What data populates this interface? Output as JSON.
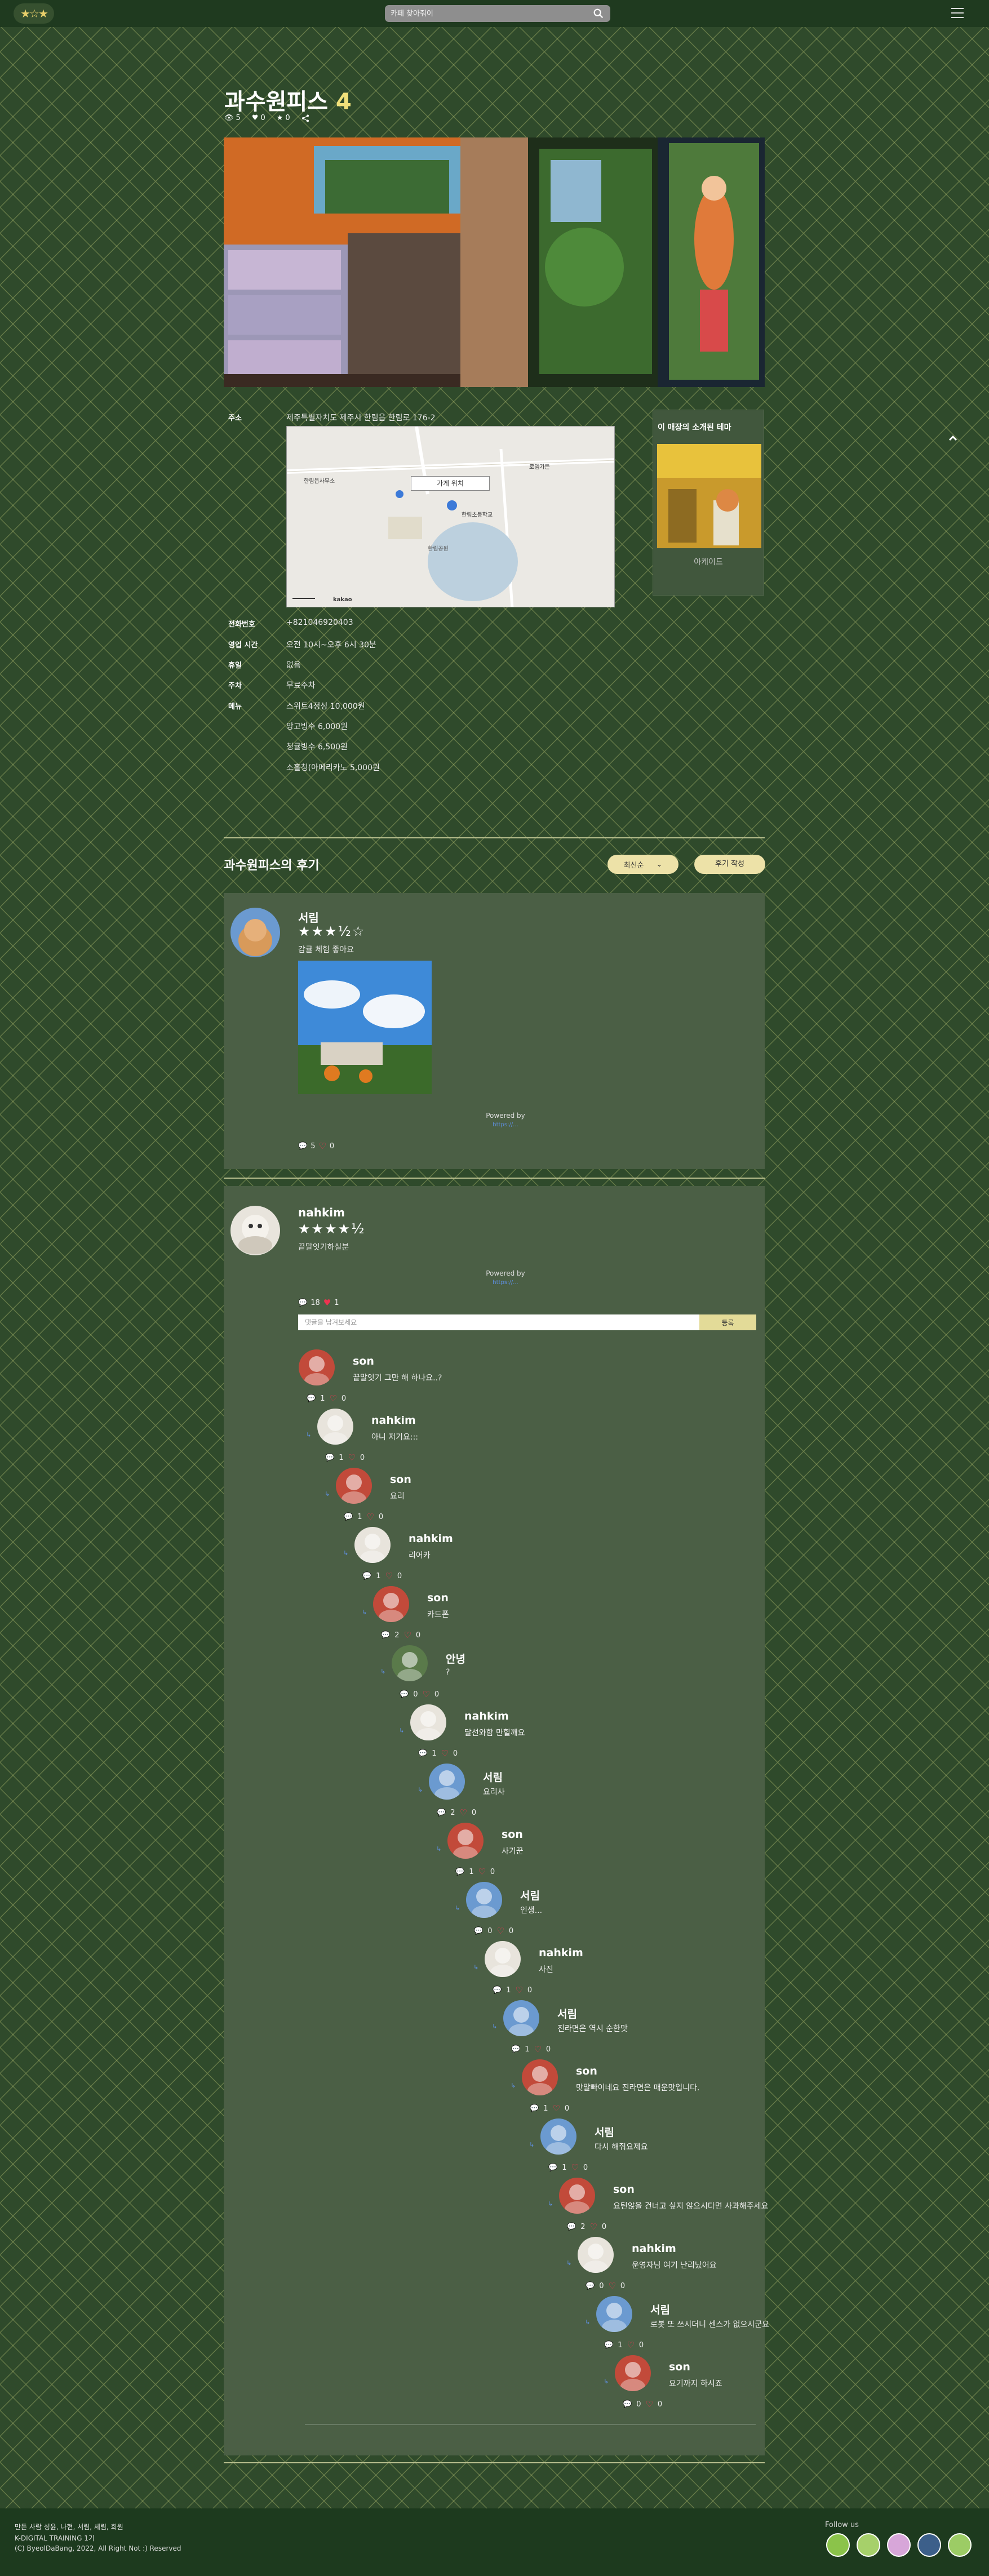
{
  "header": {
    "logo_glyph": "★☆★",
    "search_placeholder": "카페 찾아줘이",
    "search_icon": "search-icon",
    "menu_icon": "menu-icon"
  },
  "cafe": {
    "name": "과수원피스",
    "rating": "4",
    "views": "5",
    "likes": "0",
    "bookmarks": "0"
  },
  "side_card": {
    "title": "이 매장의 소개된 테마",
    "theme_name": "아케이드"
  },
  "info": {
    "address_label": "주소",
    "address": "제주특별자치도 제주시 한림읍 한림로 176-2",
    "map_button": "가게 위치",
    "phone_label": "전화번호",
    "phone": "+821046920403",
    "hours_label": "영업 시간",
    "hours": "오전 10시~오후 6시 30분",
    "closed_label": "휴일",
    "closed": "없음",
    "parking_label": "주차",
    "parking": "무료주차",
    "menu_label": "메뉴",
    "menu_items": [
      "스위트4정성 10,000원",
      "망고빙수 6,000원",
      "청귤빙수 6,500원",
      "소홀청(아메리카노 5,000원"
    ]
  },
  "map_labels": {
    "l1": "한림읍사무소",
    "l2": "한림초등학교",
    "l3": "로뎀가든",
    "l4": "한림공원",
    "l5": "kakao"
  },
  "reviews": {
    "title": "과수원피스의 후기",
    "sort_label": "최신순",
    "write_label": "후기 작성",
    "items": [
      {
        "name": "서림",
        "stars": "★★★½☆",
        "text": "감귤 체험 좋아요",
        "powered": "Powered by",
        "powered_link": "https://...",
        "comments": "5",
        "likes": "0"
      },
      {
        "name": "nahkim",
        "stars": "★★★★½",
        "text": "끝말잇기하실분",
        "powered": "Powered by",
        "powered_link": "https://...",
        "comments": "18",
        "likes": "1"
      }
    ],
    "comment_placeholder": "댓글을 남겨보세요",
    "comment_submit": "등록"
  },
  "comments": [
    {
      "name": "son",
      "text": "끝말잇기 그만 해 하나요..?",
      "replies": "1",
      "likes": "0",
      "link": ""
    },
    {
      "name": "nahkim",
      "text": "아니 저기요:::",
      "replies": "1",
      "likes": "0",
      "link": "↳"
    },
    {
      "name": "son",
      "text": "요리",
      "replies": "1",
      "likes": "0",
      "link": "↳"
    },
    {
      "name": "nahkim",
      "text": "리어카",
      "replies": "1",
      "likes": "0",
      "link": "↳"
    },
    {
      "name": "son",
      "text": "카드폰",
      "replies": "2",
      "likes": "0",
      "link": "↳"
    },
    {
      "name": "안녕",
      "text": "?",
      "replies": "0",
      "likes": "0",
      "link": "↳"
    },
    {
      "name": "nahkim",
      "text": "달선와함 만힐깨요",
      "replies": "1",
      "likes": "0",
      "link": "↳"
    },
    {
      "name": "서림",
      "text": "요리사",
      "replies": "2",
      "likes": "0",
      "link": "↳"
    },
    {
      "name": "son",
      "text": "사기꾼",
      "replies": "1",
      "likes": "0",
      "link": "↳"
    },
    {
      "name": "서림",
      "text": "인생...",
      "replies": "0",
      "likes": "0",
      "link": "↳"
    },
    {
      "name": "nahkim",
      "text": "사진",
      "replies": "1",
      "likes": "0",
      "link": "↳"
    },
    {
      "name": "서림",
      "text": "진라면은 역시 순한맛",
      "replies": "1",
      "likes": "0",
      "link": "↳"
    },
    {
      "name": "son",
      "text": "맛말빠이네요 진라면은 매운맛입니다.",
      "replies": "1",
      "likes": "0",
      "link": "↳"
    },
    {
      "name": "서림",
      "text": "다시 해줘요제요",
      "replies": "1",
      "likes": "0",
      "link": "↳"
    },
    {
      "name": "son",
      "text": "요틴않을 건너고 싶지 않으시다면 사과해주세요",
      "replies": "2",
      "likes": "0",
      "link": "↳"
    },
    {
      "name": "nahkim",
      "text": "운영자님 여기 난리났어요",
      "replies": "0",
      "likes": "0",
      "link": "↳"
    },
    {
      "name": "서림",
      "text": "로봇 또 쓰시더니 센스가 없으시군요",
      "replies": "1",
      "likes": "0",
      "link": "↳"
    },
    {
      "name": "son",
      "text": "요기까지 하시죠",
      "replies": "0",
      "likes": "0",
      "link": "↳"
    }
  ],
  "footer": {
    "line1": "만든 사람 성윤, 나현, 서림, 세림, 희원",
    "line2": "K-DIGITAL TRAINING 1기",
    "line3": "(C) ByeolDaBang, 2022, All Right Not :) Reserved",
    "follow": "Follow us"
  },
  "colors": {
    "accent": "#ede2a8",
    "heart": "#ee3350",
    "link": "#5e8fe0"
  }
}
